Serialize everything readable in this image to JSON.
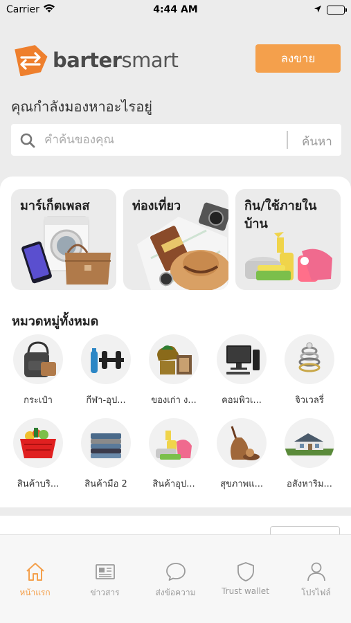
{
  "status_bar": {
    "carrier": "Carrier",
    "time": "4:44 AM"
  },
  "header": {
    "logo_bold": "barter",
    "logo_light": "smart",
    "sell_label": "ลงขาย"
  },
  "search": {
    "question": "คุณกำลังมองหาอะไรอยู่",
    "placeholder": "คำค้นของคุณ",
    "button_label": "ค้นหา"
  },
  "tiles": [
    {
      "label": "มาร์เก็ตเพลส",
      "icon": "washing-machine-phone-bag"
    },
    {
      "label": "ท่องเที่ยว",
      "icon": "map-camera-hat"
    },
    {
      "label": "กิน/ใช้ภายในบ้าน",
      "icon": "cleaning-supplies"
    }
  ],
  "categories_title": "หมวดหมู่ทั้งหมด",
  "categories": [
    {
      "label": "กระเป๋า",
      "icon": "bag-icon"
    },
    {
      "label": "กีฬา-อุป...",
      "icon": "dumbbell-icon"
    },
    {
      "label": "ของเก่า ง...",
      "icon": "antique-icon"
    },
    {
      "label": "คอมพิวเ...",
      "icon": "computer-icon"
    },
    {
      "label": "จิวเวลรี่",
      "icon": "ring-icon"
    },
    {
      "label": "สินค้าบริ...",
      "icon": "basket-icon"
    },
    {
      "label": "สินค้ามือ 2",
      "icon": "clothes-stack-icon"
    },
    {
      "label": "สินค้าอุป...",
      "icon": "cleaning-icon"
    },
    {
      "label": "สุขภาพแ...",
      "icon": "spa-icon"
    },
    {
      "label": "อสังหาริม...",
      "icon": "house-icon"
    }
  ],
  "tabbar": [
    {
      "label": "หน้าแรก",
      "icon": "home-icon",
      "active": true
    },
    {
      "label": "ข่าวสาร",
      "icon": "newspaper-icon",
      "active": false
    },
    {
      "label": "ส่งข้อความ",
      "icon": "chat-bubble-icon",
      "active": false
    },
    {
      "label": "Trust wallet",
      "icon": "shield-icon",
      "active": false
    },
    {
      "label": "โปรไฟล์",
      "icon": "user-icon",
      "active": false
    }
  ],
  "colors": {
    "accent": "#f4a04c",
    "logo_orange": "#ee7f2d"
  }
}
